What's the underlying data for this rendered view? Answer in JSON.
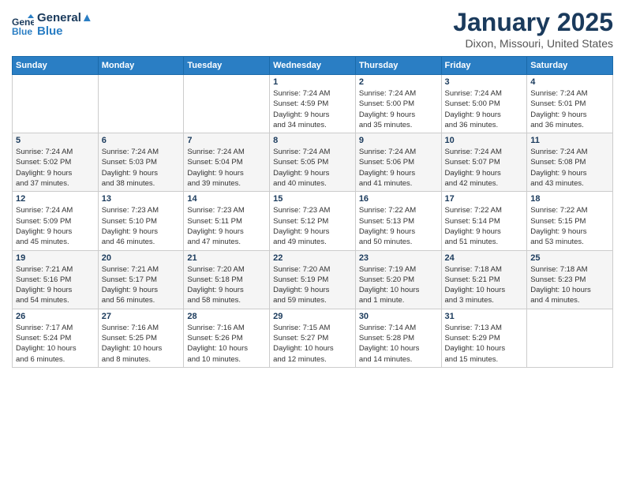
{
  "header": {
    "logo_line1": "General",
    "logo_line2": "Blue",
    "month_title": "January 2025",
    "location": "Dixon, Missouri, United States"
  },
  "days_of_week": [
    "Sunday",
    "Monday",
    "Tuesday",
    "Wednesday",
    "Thursday",
    "Friday",
    "Saturday"
  ],
  "weeks": [
    [
      {
        "day": "",
        "info": ""
      },
      {
        "day": "",
        "info": ""
      },
      {
        "day": "",
        "info": ""
      },
      {
        "day": "1",
        "info": "Sunrise: 7:24 AM\nSunset: 4:59 PM\nDaylight: 9 hours\nand 34 minutes."
      },
      {
        "day": "2",
        "info": "Sunrise: 7:24 AM\nSunset: 5:00 PM\nDaylight: 9 hours\nand 35 minutes."
      },
      {
        "day": "3",
        "info": "Sunrise: 7:24 AM\nSunset: 5:00 PM\nDaylight: 9 hours\nand 36 minutes."
      },
      {
        "day": "4",
        "info": "Sunrise: 7:24 AM\nSunset: 5:01 PM\nDaylight: 9 hours\nand 36 minutes."
      }
    ],
    [
      {
        "day": "5",
        "info": "Sunrise: 7:24 AM\nSunset: 5:02 PM\nDaylight: 9 hours\nand 37 minutes."
      },
      {
        "day": "6",
        "info": "Sunrise: 7:24 AM\nSunset: 5:03 PM\nDaylight: 9 hours\nand 38 minutes."
      },
      {
        "day": "7",
        "info": "Sunrise: 7:24 AM\nSunset: 5:04 PM\nDaylight: 9 hours\nand 39 minutes."
      },
      {
        "day": "8",
        "info": "Sunrise: 7:24 AM\nSunset: 5:05 PM\nDaylight: 9 hours\nand 40 minutes."
      },
      {
        "day": "9",
        "info": "Sunrise: 7:24 AM\nSunset: 5:06 PM\nDaylight: 9 hours\nand 41 minutes."
      },
      {
        "day": "10",
        "info": "Sunrise: 7:24 AM\nSunset: 5:07 PM\nDaylight: 9 hours\nand 42 minutes."
      },
      {
        "day": "11",
        "info": "Sunrise: 7:24 AM\nSunset: 5:08 PM\nDaylight: 9 hours\nand 43 minutes."
      }
    ],
    [
      {
        "day": "12",
        "info": "Sunrise: 7:24 AM\nSunset: 5:09 PM\nDaylight: 9 hours\nand 45 minutes."
      },
      {
        "day": "13",
        "info": "Sunrise: 7:23 AM\nSunset: 5:10 PM\nDaylight: 9 hours\nand 46 minutes."
      },
      {
        "day": "14",
        "info": "Sunrise: 7:23 AM\nSunset: 5:11 PM\nDaylight: 9 hours\nand 47 minutes."
      },
      {
        "day": "15",
        "info": "Sunrise: 7:23 AM\nSunset: 5:12 PM\nDaylight: 9 hours\nand 49 minutes."
      },
      {
        "day": "16",
        "info": "Sunrise: 7:22 AM\nSunset: 5:13 PM\nDaylight: 9 hours\nand 50 minutes."
      },
      {
        "day": "17",
        "info": "Sunrise: 7:22 AM\nSunset: 5:14 PM\nDaylight: 9 hours\nand 51 minutes."
      },
      {
        "day": "18",
        "info": "Sunrise: 7:22 AM\nSunset: 5:15 PM\nDaylight: 9 hours\nand 53 minutes."
      }
    ],
    [
      {
        "day": "19",
        "info": "Sunrise: 7:21 AM\nSunset: 5:16 PM\nDaylight: 9 hours\nand 54 minutes."
      },
      {
        "day": "20",
        "info": "Sunrise: 7:21 AM\nSunset: 5:17 PM\nDaylight: 9 hours\nand 56 minutes."
      },
      {
        "day": "21",
        "info": "Sunrise: 7:20 AM\nSunset: 5:18 PM\nDaylight: 9 hours\nand 58 minutes."
      },
      {
        "day": "22",
        "info": "Sunrise: 7:20 AM\nSunset: 5:19 PM\nDaylight: 9 hours\nand 59 minutes."
      },
      {
        "day": "23",
        "info": "Sunrise: 7:19 AM\nSunset: 5:20 PM\nDaylight: 10 hours\nand 1 minute."
      },
      {
        "day": "24",
        "info": "Sunrise: 7:18 AM\nSunset: 5:21 PM\nDaylight: 10 hours\nand 3 minutes."
      },
      {
        "day": "25",
        "info": "Sunrise: 7:18 AM\nSunset: 5:23 PM\nDaylight: 10 hours\nand 4 minutes."
      }
    ],
    [
      {
        "day": "26",
        "info": "Sunrise: 7:17 AM\nSunset: 5:24 PM\nDaylight: 10 hours\nand 6 minutes."
      },
      {
        "day": "27",
        "info": "Sunrise: 7:16 AM\nSunset: 5:25 PM\nDaylight: 10 hours\nand 8 minutes."
      },
      {
        "day": "28",
        "info": "Sunrise: 7:16 AM\nSunset: 5:26 PM\nDaylight: 10 hours\nand 10 minutes."
      },
      {
        "day": "29",
        "info": "Sunrise: 7:15 AM\nSunset: 5:27 PM\nDaylight: 10 hours\nand 12 minutes."
      },
      {
        "day": "30",
        "info": "Sunrise: 7:14 AM\nSunset: 5:28 PM\nDaylight: 10 hours\nand 14 minutes."
      },
      {
        "day": "31",
        "info": "Sunrise: 7:13 AM\nSunset: 5:29 PM\nDaylight: 10 hours\nand 15 minutes."
      },
      {
        "day": "",
        "info": ""
      }
    ]
  ]
}
